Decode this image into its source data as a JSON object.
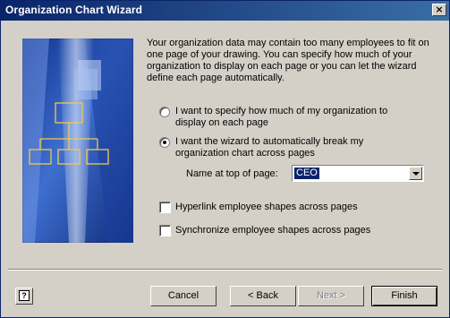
{
  "window": {
    "title": "Organization Chart Wizard",
    "close_glyph": "×"
  },
  "intro_text": "Your organization data may contain too many employees to fit on one page of your drawing.  You can specify how much of your organization to display on each page or you can let the wizard define each page automatically.",
  "options": {
    "radio1": {
      "label": "I want to specify how much of my organization to display on each page",
      "checked": false
    },
    "radio2": {
      "label": "I want the wizard to automatically break my organization chart across pages",
      "checked": true
    }
  },
  "name_at_top": {
    "label": "Name at top of page:",
    "value": "CEO"
  },
  "checkboxes": {
    "hyperlink": {
      "label": "Hyperlink employee shapes across pages",
      "checked": false
    },
    "synchronize": {
      "label": "Synchronize employee shapes across pages",
      "checked": false
    }
  },
  "buttons": {
    "help_glyph": "?",
    "cancel": "Cancel",
    "back": "< Back",
    "next": "Next >",
    "finish": "Finish"
  },
  "colors": {
    "titlebar": "#0a246a",
    "dialog": "#d4d0c8",
    "illustration_blue": "#2e5bbf",
    "org_box": "#f2c94c"
  }
}
